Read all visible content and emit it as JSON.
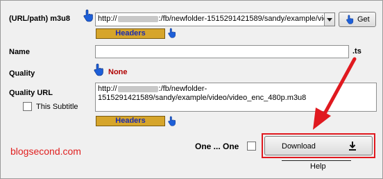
{
  "url_row": {
    "label": "(URL/path) m3u8",
    "value_prefix": "http://",
    "value_suffix": ":/fb/newfolder-1515291421589/sandy/example/vic",
    "get_label": "Get"
  },
  "headers_label": "Headers",
  "name_row": {
    "label": "Name",
    "value": "",
    "extension": ".ts"
  },
  "quality_row": {
    "label": "Quality",
    "value": "None"
  },
  "quality_url_row": {
    "label": "Quality URL",
    "line1_prefix": "http://",
    "line1_suffix": ":/fb/newfolder-",
    "line2": "1515291421589/sandy/example/video/video_enc_480p.m3u8"
  },
  "subtitle_checkbox": {
    "label": "This Subtitle",
    "checked": false
  },
  "one_by_one": {
    "label": "One ... One",
    "checked": false
  },
  "download_label": "Download",
  "help_label": "Help",
  "watermark": "blogsecond.com",
  "colors": {
    "quality_value": "#b00000",
    "highlight": "#e0191f",
    "headers_bg": "#d6a52b",
    "watermark": "#e02020"
  }
}
